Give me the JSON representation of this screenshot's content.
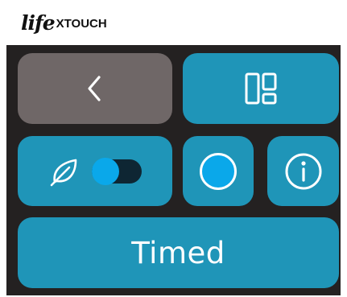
{
  "brand": {
    "script": "life",
    "word": "XTOUCH"
  },
  "colors": {
    "accent": "#1f95b8",
    "panel": "#242121",
    "back_tile": "#6f6767",
    "indicator": "#0aa8ea"
  },
  "controls": {
    "back": {
      "icon": "chevron-left-icon"
    },
    "layout": {
      "icon": "layout-panels-icon"
    },
    "eco": {
      "icon": "leaf-icon",
      "toggle_state": "on"
    },
    "status": {
      "icon": "filled-circle-icon"
    },
    "info": {
      "icon": "info-icon"
    },
    "mode_label": "Timed"
  }
}
